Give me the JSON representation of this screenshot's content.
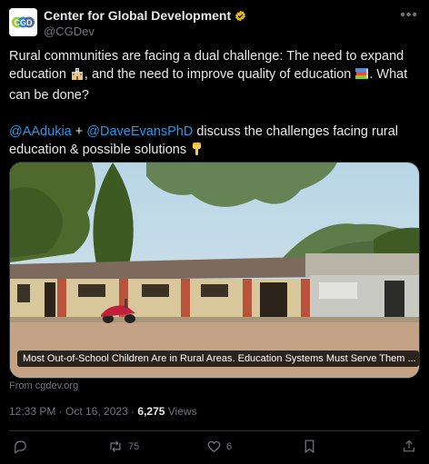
{
  "account": {
    "name": "Center for Global Development",
    "handle": "@CGDev",
    "avatar_text": "CGD"
  },
  "tweet": {
    "line1_a": "Rural communities are facing a dual challenge: The need to expand education",
    "line1_b": ", and the need to improve quality of education",
    "line1_c": ". What can be done?",
    "mention1": "@AAdukia",
    "plus": " + ",
    "mention2": "@DaveEvansPhD",
    "line2_rest": " discuss the challenges facing rural education & possible solutions"
  },
  "card": {
    "caption": "Most Out-of-School Children Are in Rural Areas. Education Systems Must Serve Them ...",
    "source": "From cgdev.org"
  },
  "meta": {
    "time": "12:33 PM · Oct 16, 2023 · ",
    "views_count": "6,275",
    "views_label": " Views"
  },
  "actions": {
    "reply_icon": "reply-icon",
    "retweets": "75",
    "likes": "6",
    "bookmark_icon": "bookmark-icon",
    "share_icon": "share-icon"
  },
  "colors": {
    "background": "#000000",
    "link": "#1d9bf0",
    "muted": "#71767b",
    "verified": "#e2b719"
  }
}
